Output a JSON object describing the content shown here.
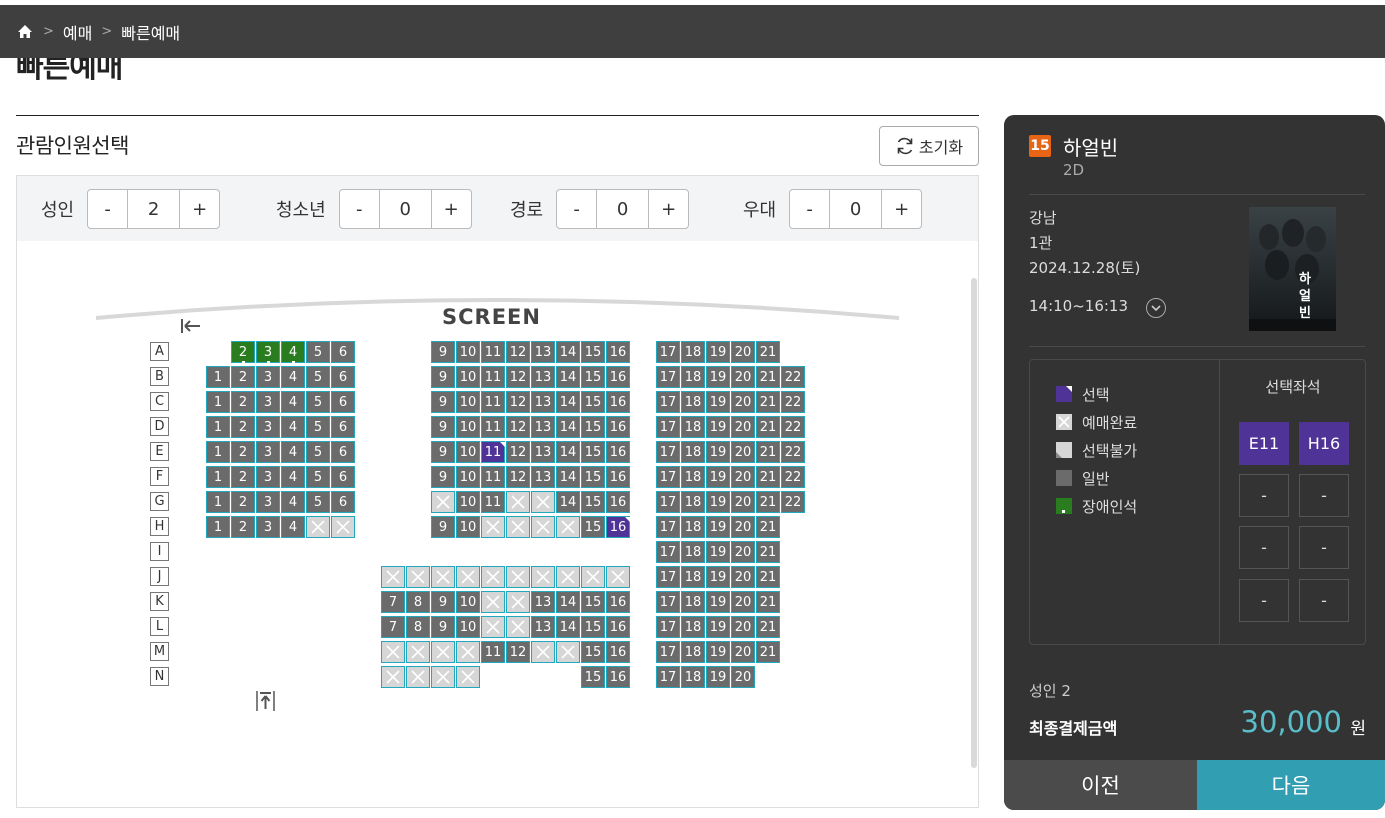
{
  "breadcrumb": {
    "items": [
      "예매",
      "빠른예매"
    ]
  },
  "page_title": "빠른예매",
  "section_title": "관람인원선택",
  "reset_label": "초기화",
  "people": [
    {
      "label": "성인",
      "count": "2"
    },
    {
      "label": "청소년",
      "count": "0"
    },
    {
      "label": "경로",
      "count": "0"
    },
    {
      "label": "우대",
      "count": "0"
    }
  ],
  "stepper": {
    "minus": "-",
    "plus": "+"
  },
  "screen_label": "SCREEN",
  "rows": [
    "A",
    "B",
    "C",
    "D",
    "E",
    "F",
    "G",
    "H",
    "I",
    "J",
    "K",
    "L",
    "M",
    "N"
  ],
  "seat_rows": [
    [
      [
        "2",
        "d"
      ],
      [
        "3",
        "d"
      ],
      [
        "4",
        "d"
      ],
      [
        "5",
        "a"
      ],
      [
        "6",
        "a"
      ],
      [
        "9",
        "a"
      ],
      [
        "10",
        "a"
      ],
      [
        "11",
        "a"
      ],
      [
        "12",
        "a"
      ],
      [
        "13",
        "a"
      ],
      [
        "14",
        "a"
      ],
      [
        "15",
        "a"
      ],
      [
        "16",
        "a"
      ],
      [
        "17",
        "a"
      ],
      [
        "18",
        "a"
      ],
      [
        "19",
        "a"
      ],
      [
        "20",
        "a"
      ],
      [
        "21",
        "a"
      ]
    ],
    [
      [
        "1",
        "a"
      ],
      [
        "2",
        "a"
      ],
      [
        "3",
        "a"
      ],
      [
        "4",
        "a"
      ],
      [
        "5",
        "a"
      ],
      [
        "6",
        "a"
      ],
      [
        "9",
        "a"
      ],
      [
        "10",
        "a"
      ],
      [
        "11",
        "a"
      ],
      [
        "12",
        "a"
      ],
      [
        "13",
        "a"
      ],
      [
        "14",
        "a"
      ],
      [
        "15",
        "a"
      ],
      [
        "16",
        "a"
      ],
      [
        "17",
        "a"
      ],
      [
        "18",
        "a"
      ],
      [
        "19",
        "a"
      ],
      [
        "20",
        "a"
      ],
      [
        "21",
        "a"
      ],
      [
        "22",
        "a"
      ]
    ],
    [
      [
        "1",
        "a"
      ],
      [
        "2",
        "a"
      ],
      [
        "3",
        "a"
      ],
      [
        "4",
        "a"
      ],
      [
        "5",
        "a"
      ],
      [
        "6",
        "a"
      ],
      [
        "9",
        "a"
      ],
      [
        "10",
        "a"
      ],
      [
        "11",
        "a"
      ],
      [
        "12",
        "a"
      ],
      [
        "13",
        "a"
      ],
      [
        "14",
        "a"
      ],
      [
        "15",
        "a"
      ],
      [
        "16",
        "a"
      ],
      [
        "17",
        "a"
      ],
      [
        "18",
        "a"
      ],
      [
        "19",
        "a"
      ],
      [
        "20",
        "a"
      ],
      [
        "21",
        "a"
      ],
      [
        "22",
        "a"
      ]
    ],
    [
      [
        "1",
        "a"
      ],
      [
        "2",
        "a"
      ],
      [
        "3",
        "a"
      ],
      [
        "4",
        "a"
      ],
      [
        "5",
        "a"
      ],
      [
        "6",
        "a"
      ],
      [
        "9",
        "a"
      ],
      [
        "10",
        "a"
      ],
      [
        "11",
        "a"
      ],
      [
        "12",
        "a"
      ],
      [
        "13",
        "a"
      ],
      [
        "14",
        "a"
      ],
      [
        "15",
        "a"
      ],
      [
        "16",
        "a"
      ],
      [
        "17",
        "a"
      ],
      [
        "18",
        "a"
      ],
      [
        "19",
        "a"
      ],
      [
        "20",
        "a"
      ],
      [
        "21",
        "a"
      ],
      [
        "22",
        "a"
      ]
    ],
    [
      [
        "1",
        "a"
      ],
      [
        "2",
        "a"
      ],
      [
        "3",
        "a"
      ],
      [
        "4",
        "a"
      ],
      [
        "5",
        "a"
      ],
      [
        "6",
        "a"
      ],
      [
        "9",
        "a"
      ],
      [
        "10",
        "a"
      ],
      [
        "11",
        "s"
      ],
      [
        "12",
        "a"
      ],
      [
        "13",
        "a"
      ],
      [
        "14",
        "a"
      ],
      [
        "15",
        "a"
      ],
      [
        "16",
        "a"
      ],
      [
        "17",
        "a"
      ],
      [
        "18",
        "a"
      ],
      [
        "19",
        "a"
      ],
      [
        "20",
        "a"
      ],
      [
        "21",
        "a"
      ],
      [
        "22",
        "a"
      ]
    ],
    [
      [
        "1",
        "a"
      ],
      [
        "2",
        "a"
      ],
      [
        "3",
        "a"
      ],
      [
        "4",
        "a"
      ],
      [
        "5",
        "a"
      ],
      [
        "6",
        "a"
      ],
      [
        "9",
        "a"
      ],
      [
        "10",
        "a"
      ],
      [
        "11",
        "a"
      ],
      [
        "12",
        "a"
      ],
      [
        "13",
        "a"
      ],
      [
        "14",
        "a"
      ],
      [
        "15",
        "a"
      ],
      [
        "16",
        "a"
      ],
      [
        "17",
        "a"
      ],
      [
        "18",
        "a"
      ],
      [
        "19",
        "a"
      ],
      [
        "20",
        "a"
      ],
      [
        "21",
        "a"
      ],
      [
        "22",
        "a"
      ]
    ],
    [
      [
        "1",
        "a"
      ],
      [
        "2",
        "a"
      ],
      [
        "3",
        "a"
      ],
      [
        "4",
        "a"
      ],
      [
        "5",
        "a"
      ],
      [
        "6",
        "a"
      ],
      [
        "",
        "x"
      ],
      [
        "10",
        "a"
      ],
      [
        "11",
        "a"
      ],
      [
        "",
        "x"
      ],
      [
        "",
        "x"
      ],
      [
        "14",
        "a"
      ],
      [
        "15",
        "a"
      ],
      [
        "16",
        "a"
      ],
      [
        "17",
        "a"
      ],
      [
        "18",
        "a"
      ],
      [
        "19",
        "a"
      ],
      [
        "20",
        "a"
      ],
      [
        "21",
        "a"
      ],
      [
        "22",
        "a"
      ]
    ],
    [
      [
        "1",
        "a"
      ],
      [
        "2",
        "a"
      ],
      [
        "3",
        "a"
      ],
      [
        "4",
        "a"
      ],
      [
        "",
        "x"
      ],
      [
        "",
        "x"
      ],
      [
        "9",
        "a"
      ],
      [
        "10",
        "a"
      ],
      [
        "",
        "x"
      ],
      [
        "",
        "x"
      ],
      [
        "",
        "x"
      ],
      [
        "",
        "x"
      ],
      [
        "15",
        "a"
      ],
      [
        "16",
        "s"
      ],
      [
        "17",
        "a"
      ],
      [
        "18",
        "a"
      ],
      [
        "19",
        "a"
      ],
      [
        "20",
        "a"
      ],
      [
        "21",
        "a"
      ]
    ],
    [
      [
        "17",
        "a"
      ],
      [
        "18",
        "a"
      ],
      [
        "19",
        "a"
      ],
      [
        "20",
        "a"
      ],
      [
        "21",
        "a"
      ]
    ],
    [
      [
        "",
        "x"
      ],
      [
        "",
        "x"
      ],
      [
        "",
        "x"
      ],
      [
        "",
        "x"
      ],
      [
        "",
        "x"
      ],
      [
        "",
        "x"
      ],
      [
        "",
        "x"
      ],
      [
        "",
        "x"
      ],
      [
        "",
        "x"
      ],
      [
        "",
        "x"
      ],
      [
        "17",
        "a"
      ],
      [
        "18",
        "a"
      ],
      [
        "19",
        "a"
      ],
      [
        "20",
        "a"
      ],
      [
        "21",
        "a"
      ]
    ],
    [
      [
        "7",
        "a"
      ],
      [
        "8",
        "a"
      ],
      [
        "9",
        "a"
      ],
      [
        "10",
        "a"
      ],
      [
        "",
        "x"
      ],
      [
        "",
        "x"
      ],
      [
        "13",
        "a"
      ],
      [
        "14",
        "a"
      ],
      [
        "15",
        "a"
      ],
      [
        "16",
        "a"
      ],
      [
        "17",
        "a"
      ],
      [
        "18",
        "a"
      ],
      [
        "19",
        "a"
      ],
      [
        "20",
        "a"
      ],
      [
        "21",
        "a"
      ]
    ],
    [
      [
        "7",
        "a"
      ],
      [
        "8",
        "a"
      ],
      [
        "9",
        "a"
      ],
      [
        "10",
        "a"
      ],
      [
        "",
        "x"
      ],
      [
        "",
        "x"
      ],
      [
        "13",
        "a"
      ],
      [
        "14",
        "a"
      ],
      [
        "15",
        "a"
      ],
      [
        "16",
        "a"
      ],
      [
        "17",
        "a"
      ],
      [
        "18",
        "a"
      ],
      [
        "19",
        "a"
      ],
      [
        "20",
        "a"
      ],
      [
        "21",
        "a"
      ]
    ],
    [
      [
        "",
        "x"
      ],
      [
        "",
        "x"
      ],
      [
        "",
        "x"
      ],
      [
        "",
        "x"
      ],
      [
        "11",
        "a"
      ],
      [
        "12",
        "a"
      ],
      [
        "",
        "x"
      ],
      [
        "",
        "x"
      ],
      [
        "15",
        "a"
      ],
      [
        "16",
        "a"
      ],
      [
        "17",
        "a"
      ],
      [
        "18",
        "a"
      ],
      [
        "19",
        "a"
      ],
      [
        "20",
        "a"
      ],
      [
        "21",
        "a"
      ]
    ],
    [
      [
        "",
        "x"
      ],
      [
        "",
        "x"
      ],
      [
        "",
        "x"
      ],
      [
        "",
        "x"
      ],
      [
        "15",
        "a"
      ],
      [
        "16",
        "a"
      ],
      [
        "17",
        "a"
      ],
      [
        "18",
        "a"
      ],
      [
        "19",
        "a"
      ],
      [
        "20",
        "a"
      ]
    ]
  ],
  "movie": {
    "rating": "15",
    "title": "하얼빈",
    "format": "2D",
    "theater": "강남",
    "hall": "1관",
    "date": "2024.12.28(토)",
    "time": "14:10~16:13",
    "poster_text": "하얼빈"
  },
  "legend": [
    "선택",
    "예매완료",
    "선택불가",
    "일반",
    "장애인석"
  ],
  "selected_seats_title": "선택좌석",
  "selected_seats": [
    "E11",
    "H16",
    "-",
    "-",
    "-",
    "-",
    "-",
    "-"
  ],
  "summary": {
    "people": "성인 2",
    "final_label": "최종결제금액",
    "amount": "30,000",
    "unit": "원"
  },
  "buttons": {
    "prev": "이전",
    "next": "다음"
  },
  "colors": {
    "selected": "#503396",
    "accessible": "#2a7d1f",
    "normal": "#6b6b6b",
    "booked": "#d6d6d6",
    "accent": "#329eb1",
    "rating15": "#e76514"
  }
}
